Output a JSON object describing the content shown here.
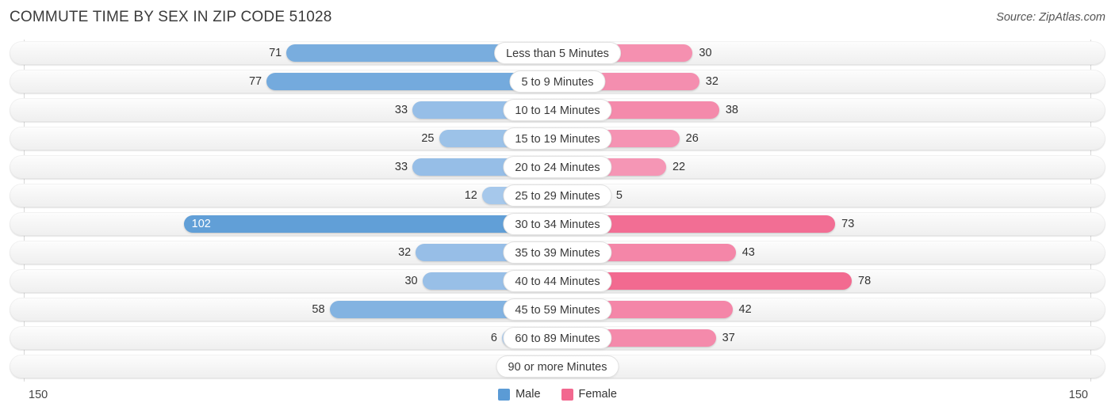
{
  "header": {
    "title": "COMMUTE TIME BY SEX IN ZIP CODE 51028",
    "source": "Source: ZipAtlas.com"
  },
  "legend": {
    "male_label": "Male",
    "female_label": "Female",
    "male_color": "#5B9BD5",
    "female_color": "#F2688F"
  },
  "axis": {
    "left_label": "150",
    "right_label": "150",
    "max": 150
  },
  "chart_data": {
    "type": "bar",
    "orientation": "horizontal-diverging",
    "title": "COMMUTE TIME BY SEX IN ZIP CODE 51028",
    "xlabel": "",
    "ylabel": "",
    "xlim": [
      150,
      150
    ],
    "grid": false,
    "legend_position": "bottom-center",
    "categories": [
      "Less than 5 Minutes",
      "5 to 9 Minutes",
      "10 to 14 Minutes",
      "15 to 19 Minutes",
      "20 to 24 Minutes",
      "25 to 29 Minutes",
      "30 to 34 Minutes",
      "35 to 39 Minutes",
      "40 to 44 Minutes",
      "45 to 59 Minutes",
      "60 to 89 Minutes",
      "90 or more Minutes"
    ],
    "series": [
      {
        "name": "Male",
        "color": "#5B9BD5",
        "values": [
          71,
          77,
          33,
          25,
          33,
          12,
          102,
          32,
          30,
          58,
          6,
          0
        ]
      },
      {
        "name": "Female",
        "color": "#F2688F",
        "values": [
          30,
          32,
          38,
          26,
          22,
          5,
          73,
          43,
          78,
          42,
          37,
          0
        ]
      }
    ]
  },
  "rows": [
    {
      "label": "Less than 5 Minutes",
      "male": "71",
      "female": "30"
    },
    {
      "label": "5 to 9 Minutes",
      "male": "77",
      "female": "32"
    },
    {
      "label": "10 to 14 Minutes",
      "male": "33",
      "female": "38"
    },
    {
      "label": "15 to 19 Minutes",
      "male": "25",
      "female": "26"
    },
    {
      "label": "20 to 24 Minutes",
      "male": "33",
      "female": "22"
    },
    {
      "label": "25 to 29 Minutes",
      "male": "12",
      "female": "5"
    },
    {
      "label": "30 to 34 Minutes",
      "male": "102",
      "female": "73"
    },
    {
      "label": "35 to 39 Minutes",
      "male": "32",
      "female": "43"
    },
    {
      "label": "40 to 44 Minutes",
      "male": "30",
      "female": "78"
    },
    {
      "label": "45 to 59 Minutes",
      "male": "58",
      "female": "42"
    },
    {
      "label": "60 to 89 Minutes",
      "male": "6",
      "female": "37"
    },
    {
      "label": "90 or more Minutes",
      "male": "0",
      "female": "0"
    }
  ]
}
